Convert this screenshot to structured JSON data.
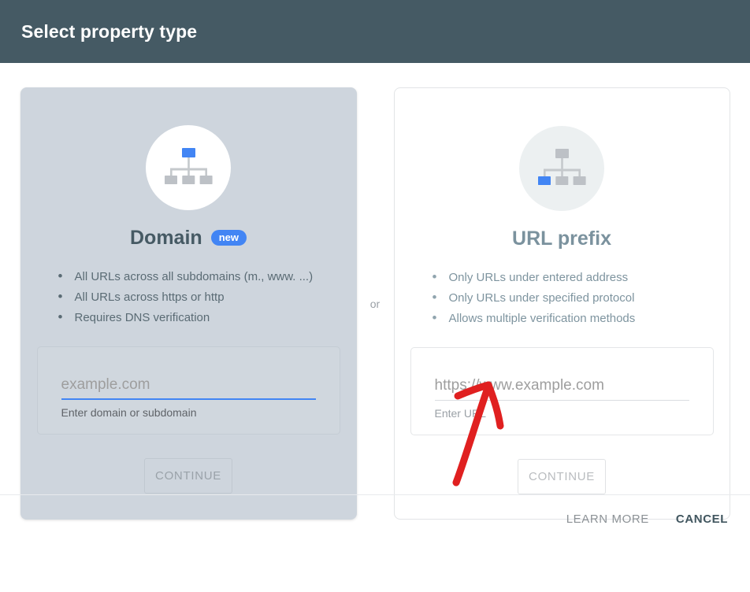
{
  "header": {
    "title": "Select property type",
    "background_color": "#455a64"
  },
  "divider": {
    "or_label": "or"
  },
  "cards": [
    {
      "id": "domain",
      "title": "Domain",
      "badge": "new",
      "icon": "site-hierarchy-icon",
      "highlight_node": "top",
      "selected": true,
      "features": [
        "All URLs across all subdomains (m., www. ...)",
        "All URLs across https or http",
        "Requires DNS verification"
      ],
      "input": {
        "placeholder": "example.com",
        "value": "",
        "helper": "Enter domain or subdomain",
        "focused": true
      },
      "continue_label": "CONTINUE",
      "background_color": "#ced5dd"
    },
    {
      "id": "url-prefix",
      "title": "URL prefix",
      "badge": "",
      "icon": "site-hierarchy-icon",
      "highlight_node": "bottom-left",
      "selected": false,
      "features": [
        "Only URLs under entered address",
        "Only URLs under specified protocol",
        "Allows multiple verification methods"
      ],
      "input": {
        "placeholder": "https://www.example.com",
        "value": "",
        "helper": "Enter URL",
        "focused": false
      },
      "continue_label": "CONTINUE",
      "background_color": "#ffffff"
    }
  ],
  "footer": {
    "learn_more_label": "LEARN MORE",
    "cancel_label": "CANCEL"
  },
  "annotation": {
    "type": "hand-drawn-arrow",
    "color": "#e02020",
    "points_to": "url-prefix-input"
  },
  "colors": {
    "accent_blue": "#4285f4",
    "header_slate": "#455a64",
    "annotation_red": "#e02020",
    "icon_grey": "#bdc1c6"
  }
}
